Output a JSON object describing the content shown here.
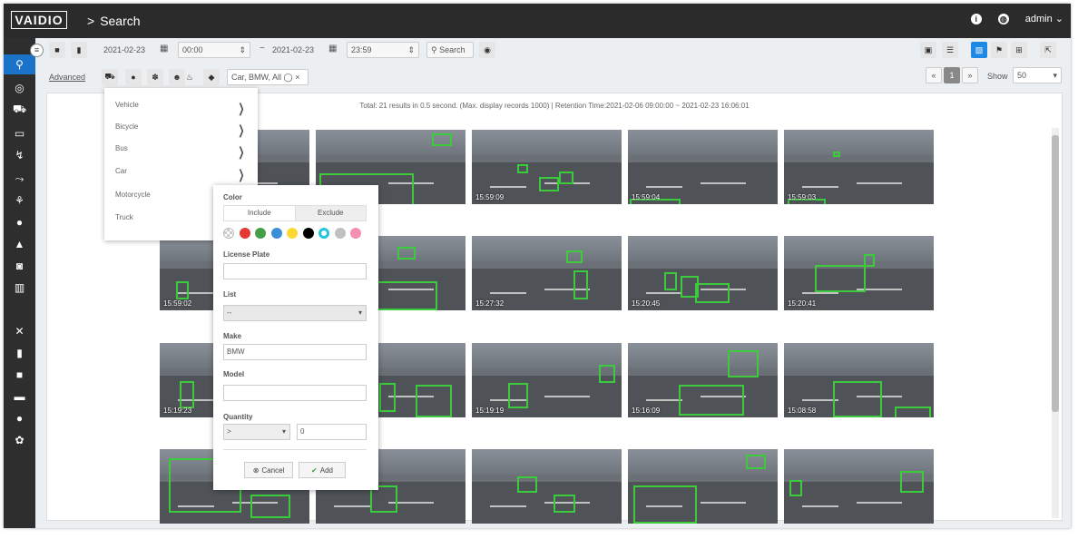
{
  "header": {
    "logo": "VAIDIO",
    "breadcrumb_sep": ">",
    "page_title": "Search",
    "user": "admin"
  },
  "toolbar": {
    "start_date": "2021-02-23",
    "start_time": "00:00",
    "range_sep": "~",
    "end_date": "2021-02-23",
    "end_time": "23:59",
    "search_label": "Search",
    "advanced_label": "Advanced",
    "filter_chip": "Car, BMW, All",
    "page_number": "1",
    "show_label": "Show",
    "show_value": "50"
  },
  "status": "Total: 21 results in 0.5 second. (Max. display records 1000) | Retention Time:2021-02-06 09:00:00 ~ 2021-02-23 16:06:01",
  "menu": {
    "items": [
      "Vehicle",
      "Bicycle",
      "Bus",
      "Car",
      "Motorcycle",
      "Truck"
    ]
  },
  "panel": {
    "color_label": "Color",
    "include_label": "Include",
    "exclude_label": "Exclude",
    "swatches": [
      "#ffffff",
      "#e53935",
      "#43a047",
      "#3b8fd9",
      "#fdd835",
      "#000000",
      "#22c4e0",
      "#c0c0c0",
      "#f48fb1"
    ],
    "license_label": "License Plate",
    "license_value": "",
    "list_label": "List",
    "list_value": "--",
    "make_label": "Make",
    "make_value": "BMW",
    "model_label": "Model",
    "model_value": "",
    "quantity_label": "Quantity",
    "quantity_op": ">",
    "quantity_value": "0",
    "cancel_label": "Cancel",
    "add_label": "Add"
  },
  "results": [
    {
      "time": ""
    },
    {
      "time": ""
    },
    {
      "time": "15:59:09"
    },
    {
      "time": "15:59:04"
    },
    {
      "time": "15:59:03"
    },
    {
      "time": "15:59:02"
    },
    {
      "time": ""
    },
    {
      "time": "15:27:32"
    },
    {
      "time": "15:20:45"
    },
    {
      "time": "15:20:41"
    },
    {
      "time": "15:19:23"
    },
    {
      "time": ""
    },
    {
      "time": "15:19:19"
    },
    {
      "time": "15:16:09"
    },
    {
      "time": "15:08:58"
    },
    {
      "time": ""
    },
    {
      "time": ""
    },
    {
      "time": ""
    },
    {
      "time": ""
    },
    {
      "time": ""
    }
  ],
  "icons": {
    "sidebar": [
      "search-icon",
      "camera-focus-icon",
      "car-icon",
      "id-card-icon",
      "route-icon",
      "person-route-icon",
      "running-icon",
      "alert-icon",
      "bell-icon",
      "face-scan-icon",
      "chart-icon",
      "tools-icon",
      "file-icon",
      "video-icon",
      "device-icon",
      "user-icon",
      "gears-icon"
    ]
  }
}
